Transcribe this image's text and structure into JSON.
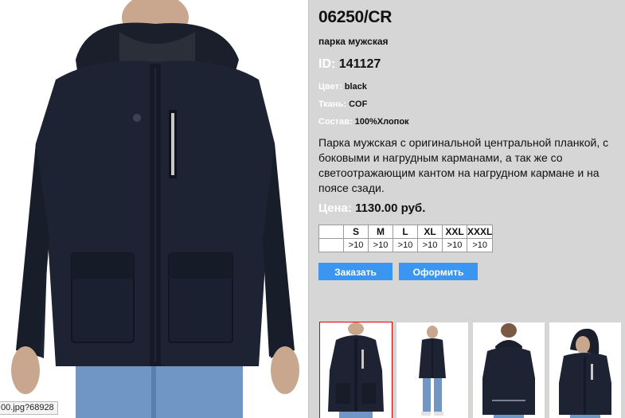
{
  "status_bar": {
    "text": "00.jpg?68928"
  },
  "product": {
    "sku": "06250/CR",
    "subtitle": "парка мужская",
    "id_label": "ID:",
    "id_value": "141127",
    "attributes": [
      {
        "label": "Цвет:",
        "value": "black"
      },
      {
        "label": "Ткань:",
        "value": "COF"
      },
      {
        "label": "Состав:",
        "value": "100%Хлопок"
      }
    ],
    "description": "Парка мужская с оригинальной центральной планкой, с боковыми и нагрудным карманами, а так же со светоотражающим кантом на нагрудном кармане и на поясе сзади.",
    "price_label": "Цена:",
    "price_value": "1130.00 руб."
  },
  "sizes": {
    "headers": [
      "S",
      "M",
      "L",
      "XL",
      "XXL",
      "XXXL"
    ],
    "stock": [
      ">10",
      ">10",
      ">10",
      ">10",
      ">10",
      ">10"
    ]
  },
  "buttons": {
    "order_label": "Заказать",
    "checkout_label": "Оформить"
  },
  "thumbnails": [
    {
      "icon": "jacket-front-photo",
      "selected": true
    },
    {
      "icon": "model-full-length-photo",
      "selected": false
    },
    {
      "icon": "jacket-back-photo",
      "selected": false
    },
    {
      "icon": "jacket-side-hood-photo",
      "selected": false
    }
  ],
  "colors": {
    "page_bg": "#d6d6d6",
    "button_bg": "#3a96f0",
    "label_text": "#ffffff",
    "jacket": "#1d2333",
    "selected_thumb_border": "#d40000"
  }
}
